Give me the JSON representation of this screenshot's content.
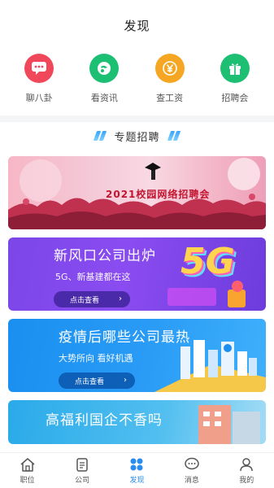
{
  "header": {
    "title": "发现"
  },
  "quick_links": [
    {
      "label": "聊八卦",
      "icon": "chat-bubble-icon",
      "color": "#f0475a"
    },
    {
      "label": "看资讯",
      "icon": "news-icon",
      "color": "#1dbf73"
    },
    {
      "label": "查工资",
      "icon": "yen-coin-icon",
      "color": "#f5a623"
    },
    {
      "label": "招聘会",
      "icon": "gift-box-icon",
      "color": "#1dbf73"
    }
  ],
  "section": {
    "title": "专题招聘"
  },
  "banners": [
    {
      "heading": "2021校园网络招聘会"
    },
    {
      "heading": "新风口公司出炉",
      "sub": "5G、新基建都在这",
      "button": "点击查看",
      "badge": "5G"
    },
    {
      "heading": "疫情后哪些公司最热",
      "sub": "大势所向  看好机遇",
      "button": "点击查看"
    },
    {
      "heading": "高福利国企不香吗"
    }
  ],
  "tabbar": [
    {
      "label": "职位",
      "icon": "home-icon",
      "active": false
    },
    {
      "label": "公司",
      "icon": "clipboard-icon",
      "active": false
    },
    {
      "label": "发现",
      "icon": "discover-dots-icon",
      "active": true
    },
    {
      "label": "消息",
      "icon": "message-icon",
      "active": false
    },
    {
      "label": "我的",
      "icon": "profile-icon",
      "active": false
    }
  ],
  "colors": {
    "accent": "#2a8cf0"
  }
}
